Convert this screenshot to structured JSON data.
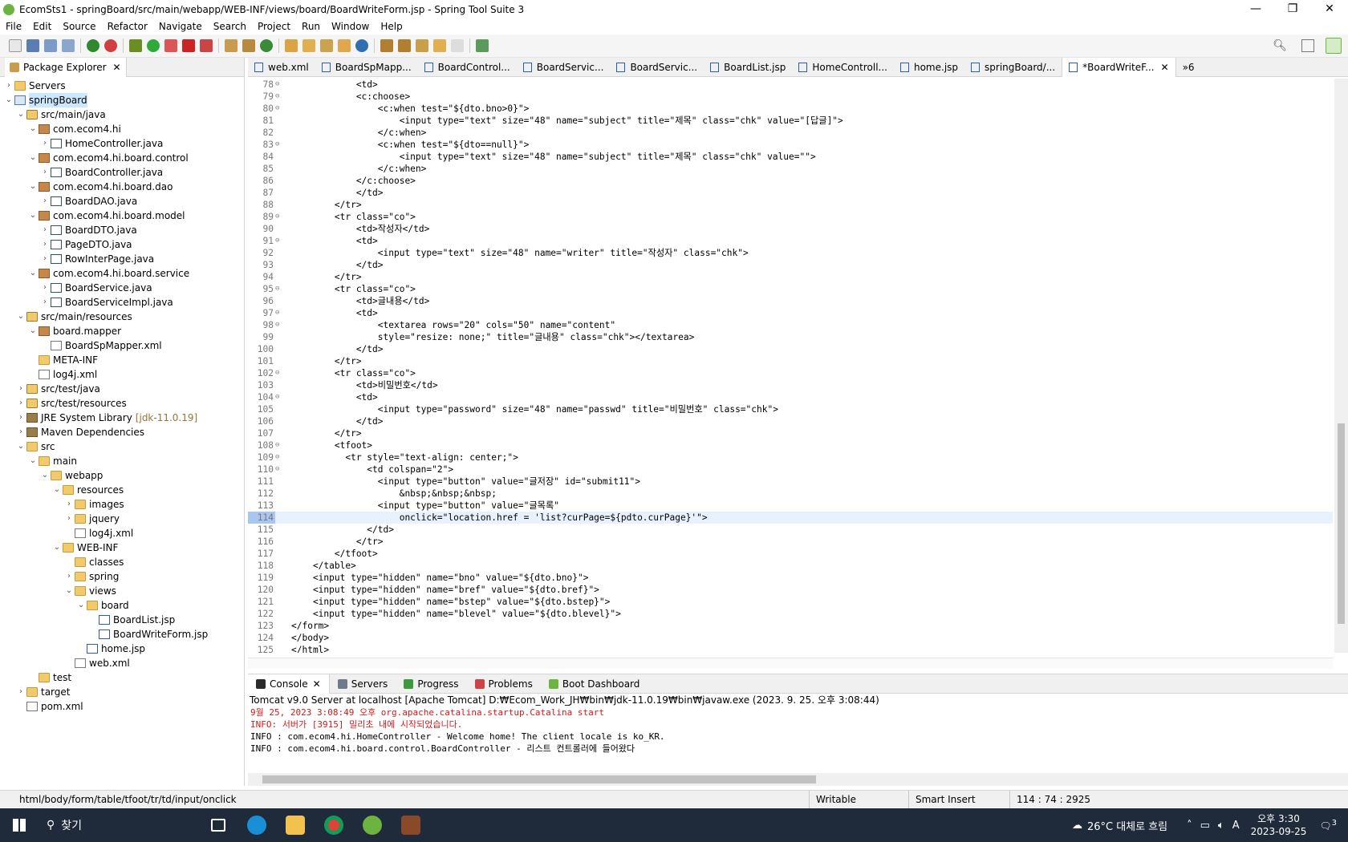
{
  "window": {
    "title": "EcomSts1 - springBoard/src/main/webapp/WEB-INF/views/board/BoardWriteForm.jsp - Spring Tool Suite 3",
    "controls": [
      "—",
      "❐",
      "✕"
    ]
  },
  "menu": [
    "File",
    "Edit",
    "Source",
    "Refactor",
    "Navigate",
    "Search",
    "Project",
    "Run",
    "Window",
    "Help"
  ],
  "package_explorer": {
    "tab_label": "Package Explorer",
    "tree": [
      {
        "indent": 0,
        "tw": "›",
        "icon": "folder",
        "label": "Servers"
      },
      {
        "indent": 0,
        "tw": "⌄",
        "icon": "proj",
        "label": "springBoard",
        "selected": true
      },
      {
        "indent": 1,
        "tw": "⌄",
        "icon": "srcfolder",
        "label": "src/main/java"
      },
      {
        "indent": 2,
        "tw": "⌄",
        "icon": "pkgi",
        "label": "com.ecom4.hi"
      },
      {
        "indent": 3,
        "tw": "›",
        "icon": "java",
        "label": "HomeController.java"
      },
      {
        "indent": 2,
        "tw": "⌄",
        "icon": "pkgi",
        "label": "com.ecom4.hi.board.control"
      },
      {
        "indent": 3,
        "tw": "›",
        "icon": "java",
        "label": "BoardController.java"
      },
      {
        "indent": 2,
        "tw": "⌄",
        "icon": "pkgi",
        "label": "com.ecom4.hi.board.dao"
      },
      {
        "indent": 3,
        "tw": "›",
        "icon": "java",
        "label": "BoardDAO.java"
      },
      {
        "indent": 2,
        "tw": "⌄",
        "icon": "pkgi",
        "label": "com.ecom4.hi.board.model"
      },
      {
        "indent": 3,
        "tw": "›",
        "icon": "java",
        "label": "BoardDTO.java"
      },
      {
        "indent": 3,
        "tw": "›",
        "icon": "java",
        "label": "PageDTO.java"
      },
      {
        "indent": 3,
        "tw": "›",
        "icon": "java",
        "label": "RowInterPage.java"
      },
      {
        "indent": 2,
        "tw": "⌄",
        "icon": "pkgi",
        "label": "com.ecom4.hi.board.service"
      },
      {
        "indent": 3,
        "tw": "›",
        "icon": "java",
        "label": "BoardService.java"
      },
      {
        "indent": 3,
        "tw": "›",
        "icon": "java",
        "label": "BoardServiceImpl.java"
      },
      {
        "indent": 1,
        "tw": "⌄",
        "icon": "srcfolder",
        "label": "src/main/resources"
      },
      {
        "indent": 2,
        "tw": "⌄",
        "icon": "pkgi",
        "label": "board.mapper"
      },
      {
        "indent": 3,
        "tw": "",
        "icon": "xml",
        "label": "BoardSpMapper.xml"
      },
      {
        "indent": 2,
        "tw": "",
        "icon": "folder",
        "label": "META-INF"
      },
      {
        "indent": 2,
        "tw": "",
        "icon": "xml",
        "label": "log4j.xml"
      },
      {
        "indent": 1,
        "tw": "›",
        "icon": "srcfolder",
        "label": "src/test/java"
      },
      {
        "indent": 1,
        "tw": "›",
        "icon": "srcfolder",
        "label": "src/test/resources"
      },
      {
        "indent": 1,
        "tw": "›",
        "icon": "lib",
        "label": "JRE System Library",
        "decor": "[jdk-11.0.19]"
      },
      {
        "indent": 1,
        "tw": "›",
        "icon": "lib",
        "label": "Maven Dependencies"
      },
      {
        "indent": 1,
        "tw": "⌄",
        "icon": "folder",
        "label": "src"
      },
      {
        "indent": 2,
        "tw": "⌄",
        "icon": "folder",
        "label": "main"
      },
      {
        "indent": 3,
        "tw": "⌄",
        "icon": "folder",
        "label": "webapp"
      },
      {
        "indent": 4,
        "tw": "⌄",
        "icon": "folder",
        "label": "resources"
      },
      {
        "indent": 5,
        "tw": "›",
        "icon": "folder",
        "label": "images"
      },
      {
        "indent": 5,
        "tw": "›",
        "icon": "folder",
        "label": "jquery"
      },
      {
        "indent": 5,
        "tw": "",
        "icon": "xml",
        "label": "log4j.xml"
      },
      {
        "indent": 4,
        "tw": "⌄",
        "icon": "folder",
        "label": "WEB-INF"
      },
      {
        "indent": 5,
        "tw": "",
        "icon": "folder",
        "label": "classes"
      },
      {
        "indent": 5,
        "tw": "›",
        "icon": "folder",
        "label": "spring"
      },
      {
        "indent": 5,
        "tw": "⌄",
        "icon": "folder",
        "label": "views"
      },
      {
        "indent": 6,
        "tw": "⌄",
        "icon": "folder",
        "label": "board"
      },
      {
        "indent": 7,
        "tw": "",
        "icon": "jsp",
        "label": "BoardList.jsp"
      },
      {
        "indent": 7,
        "tw": "",
        "icon": "jsp",
        "label": "BoardWriteForm.jsp"
      },
      {
        "indent": 6,
        "tw": "",
        "icon": "jsp",
        "label": "home.jsp"
      },
      {
        "indent": 5,
        "tw": "",
        "icon": "xml",
        "label": "web.xml"
      },
      {
        "indent": 2,
        "tw": "",
        "icon": "folder",
        "label": "test"
      },
      {
        "indent": 1,
        "tw": "›",
        "icon": "folder",
        "label": "target"
      },
      {
        "indent": 1,
        "tw": "",
        "icon": "xml",
        "label": "pom.xml"
      }
    ]
  },
  "editor": {
    "tabs": [
      {
        "label": "web.xml"
      },
      {
        "label": "BoardSpMapp..."
      },
      {
        "label": "BoardControl..."
      },
      {
        "label": "BoardServic..."
      },
      {
        "label": "BoardServic..."
      },
      {
        "label": "BoardList.jsp"
      },
      {
        "label": "HomeControll..."
      },
      {
        "label": "home.jsp"
      },
      {
        "label": "springBoard/..."
      },
      {
        "label": "*BoardWriteF...",
        "active": true
      }
    ],
    "overflow_label": "»6",
    "lines": [
      {
        "n": "78",
        "f": "⊖",
        "t": "            <td>"
      },
      {
        "n": "79",
        "f": "⊖",
        "t": "            <c:choose>"
      },
      {
        "n": "80",
        "f": "⊖",
        "t": "                <c:when test=\"${dto.bno>0}\">"
      },
      {
        "n": "81",
        "f": "",
        "t": "                    <input type=\"text\" size=\"48\" name=\"subject\" title=\"제목\" class=\"chk\" value=\"[답글]\">"
      },
      {
        "n": "82",
        "f": "",
        "t": "                </c:when>"
      },
      {
        "n": "83",
        "f": "⊖",
        "t": "                <c:when test=\"${dto==null}\">"
      },
      {
        "n": "84",
        "f": "",
        "t": "                    <input type=\"text\" size=\"48\" name=\"subject\" title=\"제목\" class=\"chk\" value=\"\">"
      },
      {
        "n": "85",
        "f": "",
        "t": "                </c:when>"
      },
      {
        "n": "86",
        "f": "",
        "t": "            </c:choose>"
      },
      {
        "n": "87",
        "f": "",
        "t": "            </td>"
      },
      {
        "n": "88",
        "f": "",
        "t": "        </tr>"
      },
      {
        "n": "89",
        "f": "⊖",
        "t": "        <tr class=\"co\">"
      },
      {
        "n": "90",
        "f": "",
        "t": "            <td>작성자</td>"
      },
      {
        "n": "91",
        "f": "⊖",
        "t": "            <td>"
      },
      {
        "n": "92",
        "f": "",
        "t": "                <input type=\"text\" size=\"48\" name=\"writer\" title=\"작성자\" class=\"chk\">"
      },
      {
        "n": "93",
        "f": "",
        "t": "            </td>"
      },
      {
        "n": "94",
        "f": "",
        "t": "        </tr>"
      },
      {
        "n": "95",
        "f": "⊖",
        "t": "        <tr class=\"co\">"
      },
      {
        "n": "96",
        "f": "",
        "t": "            <td>글내용</td>"
      },
      {
        "n": "97",
        "f": "⊖",
        "t": "            <td>"
      },
      {
        "n": "98",
        "f": "⊖",
        "t": "                <textarea rows=\"20\" cols=\"50\" name=\"content\""
      },
      {
        "n": "99",
        "f": "",
        "t": "                style=\"resize: none;\" title=\"글내용\" class=\"chk\"></textarea>"
      },
      {
        "n": "100",
        "f": "",
        "t": "            </td>"
      },
      {
        "n": "101",
        "f": "",
        "t": "        </tr>"
      },
      {
        "n": "102",
        "f": "⊖",
        "t": "        <tr class=\"co\">"
      },
      {
        "n": "103",
        "f": "",
        "t": "            <td>비밀번호</td>"
      },
      {
        "n": "104",
        "f": "⊖",
        "t": "            <td>"
      },
      {
        "n": "105",
        "f": "",
        "t": "                <input type=\"password\" size=\"48\" name=\"passwd\" title=\"비밀번호\" class=\"chk\">"
      },
      {
        "n": "106",
        "f": "",
        "t": "            </td>"
      },
      {
        "n": "107",
        "f": "",
        "t": "        </tr>"
      },
      {
        "n": "108",
        "f": "⊖",
        "t": "        <tfoot>"
      },
      {
        "n": "109",
        "f": "⊖",
        "t": "          <tr style=\"text-align: center;\">"
      },
      {
        "n": "110",
        "f": "⊖",
        "t": "              <td colspan=\"2\">"
      },
      {
        "n": "111",
        "f": "",
        "t": "                <input type=\"button\" value=\"글저장\" id=\"submit11\">"
      },
      {
        "n": "112",
        "f": "",
        "t": "                    &nbsp;&nbsp;&nbsp;"
      },
      {
        "n": "113",
        "f": "",
        "t": "                <input type=\"button\" value=\"글목록\""
      },
      {
        "n": "114",
        "f": "",
        "t": "                    onclick=\"location.href = 'list?curPage=${pdto.curPage}'\">",
        "current": true
      },
      {
        "n": "115",
        "f": "",
        "t": "              </td>"
      },
      {
        "n": "116",
        "f": "",
        "t": "            </tr>"
      },
      {
        "n": "117",
        "f": "",
        "t": "        </tfoot>"
      },
      {
        "n": "118",
        "f": "",
        "t": "    </table>"
      },
      {
        "n": "119",
        "f": "",
        "t": "    <input type=\"hidden\" name=\"bno\" value=\"${dto.bno}\">"
      },
      {
        "n": "120",
        "f": "",
        "t": "    <input type=\"hidden\" name=\"bref\" value=\"${dto.bref}\">"
      },
      {
        "n": "121",
        "f": "",
        "t": "    <input type=\"hidden\" name=\"bstep\" value=\"${dto.bstep}\">"
      },
      {
        "n": "122",
        "f": "",
        "t": "    <input type=\"hidden\" name=\"blevel\" value=\"${dto.blevel}\">"
      },
      {
        "n": "123",
        "f": "",
        "t": "</form>"
      },
      {
        "n": "124",
        "f": "",
        "t": "</body>"
      },
      {
        "n": "125",
        "f": "",
        "t": "</html>"
      }
    ]
  },
  "console": {
    "tabs": [
      {
        "label": "Console",
        "icon_color": "#2b2b2b",
        "active": true
      },
      {
        "label": "Servers",
        "icon_color": "#6d7b8d"
      },
      {
        "label": "Progress",
        "icon_color": "#3c9a3c"
      },
      {
        "label": "Problems",
        "icon_color": "#c44"
      },
      {
        "label": "Boot Dashboard",
        "icon_color": "#6db33f"
      }
    ],
    "header": "Tomcat v9.0 Server at localhost [Apache Tomcat] D:₩Ecom_Work_JH₩bin₩jdk-11.0.19₩bin₩javaw.exe  (2023. 9. 25. 오후 3:08:44)",
    "lines": [
      {
        "text": "9월 25, 2023 3:08:49 오후 org.apache.catalina.startup.Catalina start",
        "err": true
      },
      {
        "text": "INFO: 서버가 [3915] 밀리초 내에 시작되었습니다.",
        "err": true
      },
      {
        "text": "INFO : com.ecom4.hi.HomeController - Welcome home! The client locale is ko_KR.",
        "err": false
      },
      {
        "text": "INFO : com.ecom4.hi.board.control.BoardController - 리스트 컨트롤러에 들어왔다",
        "err": false
      }
    ]
  },
  "status": {
    "path": "html/body/form/table/tfoot/tr/td/input/onclick",
    "writable": "Writable",
    "insert_mode": "Smart Insert",
    "position": "114 : 74 : 2925"
  },
  "taskbar": {
    "search_label": "찾기",
    "weather": "26°C  대체로 흐림",
    "time": "오후 3:30",
    "date": "2023-09-25",
    "notif_count": "3"
  }
}
